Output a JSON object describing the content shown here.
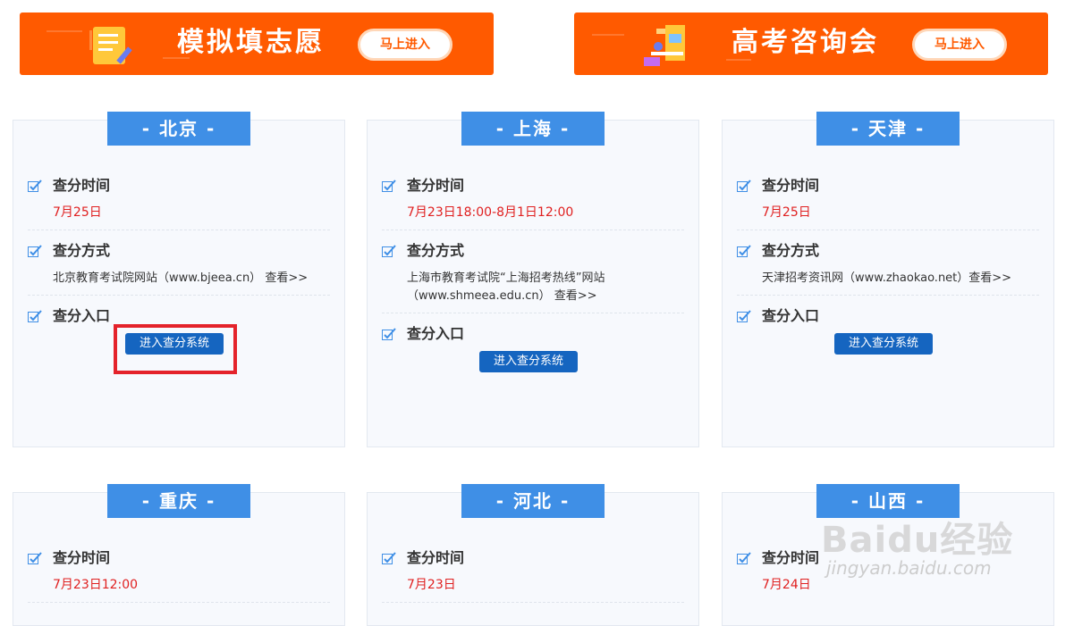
{
  "banners": [
    {
      "title": "模拟填志愿",
      "button": "马上进入"
    },
    {
      "title": "高考咨询会",
      "button": "马上进入"
    }
  ],
  "cards": [
    {
      "region": "- 北京 -",
      "time_label": "查分时间",
      "time_value": "7月25日",
      "method_label": "查分方式",
      "method_text": "北京教育考试院网站（www.bjeea.cn） 查看>>",
      "entry_label": "查分入口",
      "entry_button": "进入查分系统"
    },
    {
      "region": "- 上海 -",
      "time_label": "查分时间",
      "time_value": "7月23日18:00-8月1日12:00",
      "method_label": "查分方式",
      "method_text_line1": "上海市教育考试院“上海招考热线”网站",
      "method_text_line2": "（www.shmeea.edu.cn） 查看>>",
      "entry_label": "查分入口",
      "entry_button": "进入查分系统"
    },
    {
      "region": "- 天津 -",
      "time_label": "查分时间",
      "time_value": "7月25日",
      "method_label": "查分方式",
      "method_text": "天津招考资讯网（www.zhaokao.net）查看>>",
      "entry_label": "查分入口",
      "entry_button": "进入查分系统"
    },
    {
      "region": "- 重庆 -",
      "time_label": "查分时间",
      "time_value": "7月23日12:00"
    },
    {
      "region": "- 河北 -",
      "time_label": "查分时间",
      "time_value": "7月23日"
    },
    {
      "region": "- 山西 -",
      "time_label": "查分时间",
      "time_value": "7月24日"
    }
  ],
  "watermark": {
    "logo": "Baidu经验",
    "url": "jingyan.baidu.com"
  },
  "colors": {
    "banner": "#ff5a00",
    "header": "#3f8fe6",
    "button": "#1565c0",
    "date": "#e02020",
    "highlight": "#e4232b"
  }
}
